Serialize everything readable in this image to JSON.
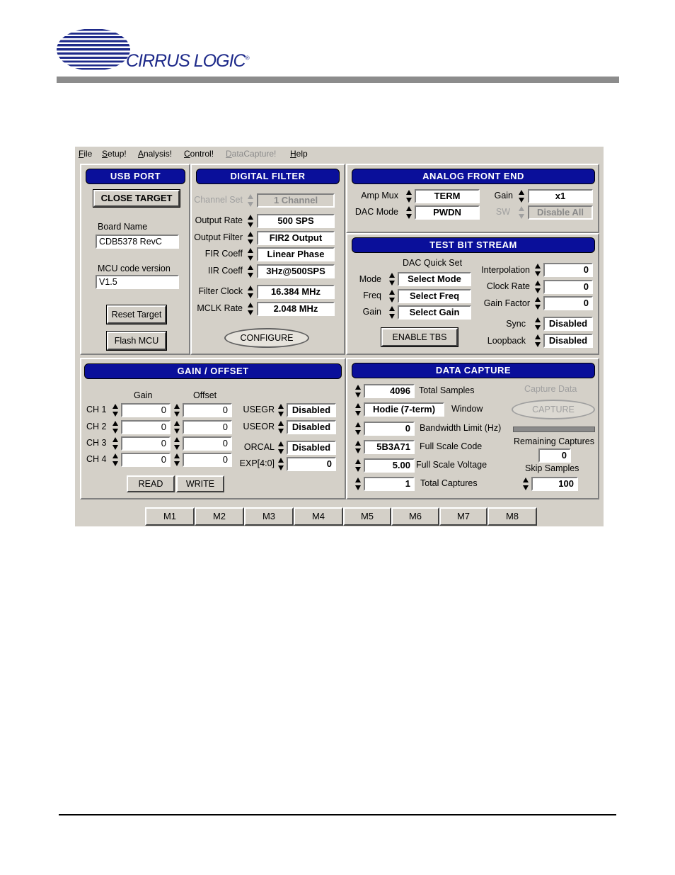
{
  "brand": {
    "name": "CIRRUS LOGIC",
    "reg": "®"
  },
  "menu": [
    {
      "label": "File",
      "u": "F",
      "rest": "ile",
      "disabled": false
    },
    {
      "label": "Setup!",
      "u": "S",
      "rest": "etup!",
      "disabled": false
    },
    {
      "label": "Analysis!",
      "u": "A",
      "rest": "nalysis!",
      "disabled": false
    },
    {
      "label": "Control!",
      "u": "C",
      "rest": "ontrol!",
      "disabled": false
    },
    {
      "label": "DataCapture!",
      "u": "D",
      "rest": "ataCapture!",
      "disabled": true
    },
    {
      "label": "Help",
      "u": "H",
      "rest": "elp",
      "disabled": false
    }
  ],
  "usb": {
    "title": "USB PORT",
    "close_target": "CLOSE TARGET",
    "board_name_label": "Board Name",
    "board_name": "CDB5378 RevC",
    "mcu_label": "MCU code version",
    "mcu_version": "V1.5",
    "reset_target": "Reset Target",
    "flash_mcu": "Flash MCU"
  },
  "filter": {
    "title": "DIGITAL FILTER",
    "channel_set_label": "Channel Set",
    "channel_set": "1 Channel",
    "output_rate_label": "Output Rate",
    "output_rate": "500 SPS",
    "output_filter_label": "Output Filter",
    "output_filter": "FIR2 Output",
    "fir_label": "FIR Coeff",
    "fir": "Linear Phase",
    "iir_label": "IIR Coeff",
    "iir": "3Hz@500SPS",
    "filter_clock_label": "Filter Clock",
    "filter_clock": "16.384 MHz",
    "mclk_label": "MCLK Rate",
    "mclk": "2.048 MHz",
    "configure": "CONFIGURE"
  },
  "afe": {
    "title": "ANALOG FRONT END",
    "amp_mux_label": "Amp Mux",
    "amp_mux": "TERM",
    "gain_label": "Gain",
    "gain": "x1",
    "dac_mode_label": "DAC Mode",
    "dac_mode": "PWDN",
    "sw_label": "SW",
    "sw": "Disable All"
  },
  "tbs": {
    "title": "TEST BIT STREAM",
    "quick_set_label": "DAC Quick Set",
    "mode_label": "Mode",
    "mode": "Select Mode",
    "freq_label": "Freq",
    "freq": "Select Freq",
    "gain_label": "Gain",
    "gain": "Select Gain",
    "interp_label": "Interpolation",
    "interp": "0",
    "clock_rate_label": "Clock Rate",
    "clock_rate": "0",
    "gain_factor_label": "Gain Factor",
    "gain_factor": "0",
    "sync_label": "Sync",
    "sync": "Disabled",
    "loopback_label": "Loopback",
    "loopback": "Disabled",
    "enable": "ENABLE TBS"
  },
  "gain_offset": {
    "title": "GAIN / OFFSET",
    "gain_header": "Gain",
    "offset_header": "Offset",
    "channels": [
      {
        "label": "CH 1",
        "gain": "0",
        "offset": "0"
      },
      {
        "label": "CH 2",
        "gain": "0",
        "offset": "0"
      },
      {
        "label": "CH 3",
        "gain": "0",
        "offset": "0"
      },
      {
        "label": "CH 4",
        "gain": "0",
        "offset": "0"
      }
    ],
    "usegr_label": "USEGR",
    "usegr": "Disabled",
    "useor_label": "USEOR",
    "useor": "Disabled",
    "orcal_label": "ORCAL",
    "orcal": "Disabled",
    "exp_label": "EXP[4:0]",
    "exp": "0",
    "read": "READ",
    "write": "WRITE"
  },
  "capture": {
    "title": "DATA CAPTURE",
    "total_samples_label": "Total Samples",
    "total_samples": "4096",
    "window_label": "Window",
    "window": "Hodie (7-term)",
    "bandwidth_label": "Bandwidth Limit (Hz)",
    "bandwidth": "0",
    "fsc_label": "Full Scale Code",
    "fsc": "5B3A71",
    "fsv_label": "Full Scale Voltage",
    "fsv": "5.00",
    "total_captures_label": "Total Captures",
    "total_captures": "1",
    "capture_data_label": "Capture Data",
    "capture_button": "CAPTURE",
    "progress": 0.0,
    "remaining_label": "Remaining Captures",
    "remaining": "0",
    "skip_label": "Skip Samples",
    "skip": "100"
  },
  "tabs": [
    "M1",
    "M2",
    "M3",
    "M4",
    "M5",
    "M6",
    "M7",
    "M8"
  ]
}
